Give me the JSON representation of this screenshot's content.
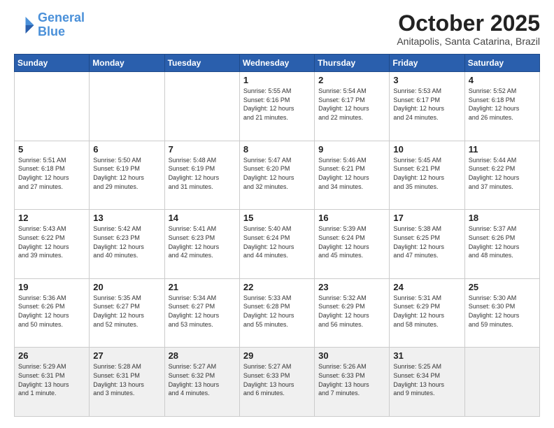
{
  "header": {
    "logo_line1": "General",
    "logo_line2": "Blue",
    "title": "October 2025",
    "subtitle": "Anitapolis, Santa Catarina, Brazil"
  },
  "days_of_week": [
    "Sunday",
    "Monday",
    "Tuesday",
    "Wednesday",
    "Thursday",
    "Friday",
    "Saturday"
  ],
  "weeks": [
    [
      {
        "day": "",
        "info": ""
      },
      {
        "day": "",
        "info": ""
      },
      {
        "day": "",
        "info": ""
      },
      {
        "day": "1",
        "info": "Sunrise: 5:55 AM\nSunset: 6:16 PM\nDaylight: 12 hours\nand 21 minutes."
      },
      {
        "day": "2",
        "info": "Sunrise: 5:54 AM\nSunset: 6:17 PM\nDaylight: 12 hours\nand 22 minutes."
      },
      {
        "day": "3",
        "info": "Sunrise: 5:53 AM\nSunset: 6:17 PM\nDaylight: 12 hours\nand 24 minutes."
      },
      {
        "day": "4",
        "info": "Sunrise: 5:52 AM\nSunset: 6:18 PM\nDaylight: 12 hours\nand 26 minutes."
      }
    ],
    [
      {
        "day": "5",
        "info": "Sunrise: 5:51 AM\nSunset: 6:18 PM\nDaylight: 12 hours\nand 27 minutes."
      },
      {
        "day": "6",
        "info": "Sunrise: 5:50 AM\nSunset: 6:19 PM\nDaylight: 12 hours\nand 29 minutes."
      },
      {
        "day": "7",
        "info": "Sunrise: 5:48 AM\nSunset: 6:19 PM\nDaylight: 12 hours\nand 31 minutes."
      },
      {
        "day": "8",
        "info": "Sunrise: 5:47 AM\nSunset: 6:20 PM\nDaylight: 12 hours\nand 32 minutes."
      },
      {
        "day": "9",
        "info": "Sunrise: 5:46 AM\nSunset: 6:21 PM\nDaylight: 12 hours\nand 34 minutes."
      },
      {
        "day": "10",
        "info": "Sunrise: 5:45 AM\nSunset: 6:21 PM\nDaylight: 12 hours\nand 35 minutes."
      },
      {
        "day": "11",
        "info": "Sunrise: 5:44 AM\nSunset: 6:22 PM\nDaylight: 12 hours\nand 37 minutes."
      }
    ],
    [
      {
        "day": "12",
        "info": "Sunrise: 5:43 AM\nSunset: 6:22 PM\nDaylight: 12 hours\nand 39 minutes."
      },
      {
        "day": "13",
        "info": "Sunrise: 5:42 AM\nSunset: 6:23 PM\nDaylight: 12 hours\nand 40 minutes."
      },
      {
        "day": "14",
        "info": "Sunrise: 5:41 AM\nSunset: 6:23 PM\nDaylight: 12 hours\nand 42 minutes."
      },
      {
        "day": "15",
        "info": "Sunrise: 5:40 AM\nSunset: 6:24 PM\nDaylight: 12 hours\nand 44 minutes."
      },
      {
        "day": "16",
        "info": "Sunrise: 5:39 AM\nSunset: 6:24 PM\nDaylight: 12 hours\nand 45 minutes."
      },
      {
        "day": "17",
        "info": "Sunrise: 5:38 AM\nSunset: 6:25 PM\nDaylight: 12 hours\nand 47 minutes."
      },
      {
        "day": "18",
        "info": "Sunrise: 5:37 AM\nSunset: 6:26 PM\nDaylight: 12 hours\nand 48 minutes."
      }
    ],
    [
      {
        "day": "19",
        "info": "Sunrise: 5:36 AM\nSunset: 6:26 PM\nDaylight: 12 hours\nand 50 minutes."
      },
      {
        "day": "20",
        "info": "Sunrise: 5:35 AM\nSunset: 6:27 PM\nDaylight: 12 hours\nand 52 minutes."
      },
      {
        "day": "21",
        "info": "Sunrise: 5:34 AM\nSunset: 6:27 PM\nDaylight: 12 hours\nand 53 minutes."
      },
      {
        "day": "22",
        "info": "Sunrise: 5:33 AM\nSunset: 6:28 PM\nDaylight: 12 hours\nand 55 minutes."
      },
      {
        "day": "23",
        "info": "Sunrise: 5:32 AM\nSunset: 6:29 PM\nDaylight: 12 hours\nand 56 minutes."
      },
      {
        "day": "24",
        "info": "Sunrise: 5:31 AM\nSunset: 6:29 PM\nDaylight: 12 hours\nand 58 minutes."
      },
      {
        "day": "25",
        "info": "Sunrise: 5:30 AM\nSunset: 6:30 PM\nDaylight: 12 hours\nand 59 minutes."
      }
    ],
    [
      {
        "day": "26",
        "info": "Sunrise: 5:29 AM\nSunset: 6:31 PM\nDaylight: 13 hours\nand 1 minute."
      },
      {
        "day": "27",
        "info": "Sunrise: 5:28 AM\nSunset: 6:31 PM\nDaylight: 13 hours\nand 3 minutes."
      },
      {
        "day": "28",
        "info": "Sunrise: 5:27 AM\nSunset: 6:32 PM\nDaylight: 13 hours\nand 4 minutes."
      },
      {
        "day": "29",
        "info": "Sunrise: 5:27 AM\nSunset: 6:33 PM\nDaylight: 13 hours\nand 6 minutes."
      },
      {
        "day": "30",
        "info": "Sunrise: 5:26 AM\nSunset: 6:33 PM\nDaylight: 13 hours\nand 7 minutes."
      },
      {
        "day": "31",
        "info": "Sunrise: 5:25 AM\nSunset: 6:34 PM\nDaylight: 13 hours\nand 9 minutes."
      },
      {
        "day": "",
        "info": ""
      }
    ]
  ]
}
